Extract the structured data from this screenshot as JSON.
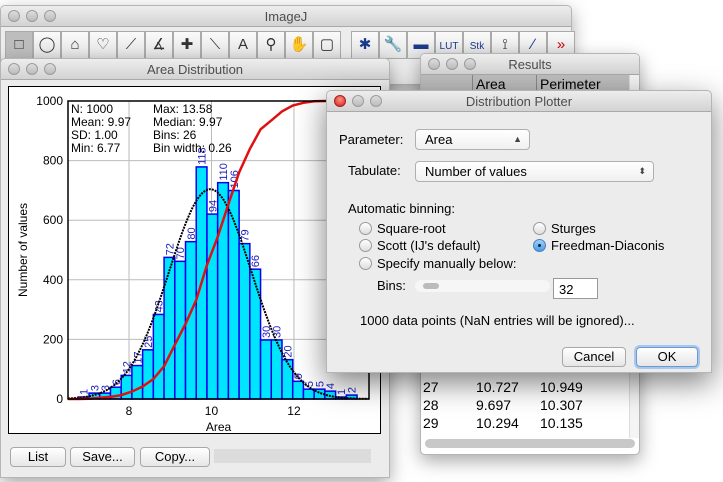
{
  "imagej": {
    "title": "ImageJ",
    "tools": [
      {
        "icon": "rectangle-icon",
        "glyph": "□"
      },
      {
        "icon": "oval-icon",
        "glyph": "◯"
      },
      {
        "icon": "polygon-icon",
        "glyph": "⌂"
      },
      {
        "icon": "freehand-icon",
        "glyph": "♡"
      },
      {
        "icon": "line-icon",
        "glyph": "⟋"
      },
      {
        "icon": "angle-icon",
        "glyph": "∡"
      },
      {
        "icon": "point-icon",
        "glyph": "✚"
      },
      {
        "icon": "wand-icon",
        "glyph": "⟍"
      },
      {
        "icon": "text-icon",
        "glyph": "A"
      },
      {
        "icon": "magnifier-icon",
        "glyph": "⚲"
      },
      {
        "icon": "hand-icon",
        "glyph": "✋"
      },
      {
        "icon": "color-picker-icon",
        "glyph": "▢"
      },
      {
        "icon": "gear-icon",
        "glyph": "✱"
      },
      {
        "icon": "wrench-icon",
        "glyph": "🔧"
      },
      {
        "icon": "folder-icon",
        "glyph": "▬"
      },
      {
        "icon": "lut-icon",
        "glyph": "LUT"
      },
      {
        "icon": "stack-icon",
        "glyph": "Stk"
      },
      {
        "icon": "microscope-icon",
        "glyph": "⟟"
      },
      {
        "icon": "brush-icon",
        "glyph": "∕"
      },
      {
        "icon": "more-tools-icon",
        "glyph": "»"
      }
    ]
  },
  "area_distribution": {
    "title": "Area Distribution",
    "buttons": {
      "list": "List",
      "save": "Save...",
      "copy": "Copy..."
    }
  },
  "results": {
    "title": "Results",
    "columns": [
      "",
      "Area",
      "Perimeter"
    ],
    "rows": [
      [
        "27",
        "10.727",
        "10.949"
      ],
      [
        "28",
        "9.697",
        "10.307"
      ],
      [
        "29",
        "10.294",
        "10.135"
      ]
    ]
  },
  "dialog": {
    "title": "Distribution Plotter",
    "parameter_label": "Parameter:",
    "parameter_value": "Area",
    "tabulate_label": "Tabulate:",
    "tabulate_value": "Number of values",
    "binning_label": "Automatic binning:",
    "options": {
      "square_root": "Square-root",
      "sturges": "Sturges",
      "scott": "Scott (IJ's default)",
      "freedman": "Freedman-Diaconis",
      "manual": "Specify manually below:"
    },
    "selected": "freedman",
    "bins_label": "Bins:",
    "bins_value": "32",
    "info": "1000 data points (NaN entries will be ignored)...",
    "cancel": "Cancel",
    "ok": "OK"
  },
  "chart_data": {
    "type": "bar",
    "xlabel": "Area",
    "ylabel": "Number of values",
    "xlim": [
      6.52,
      13.82
    ],
    "ylim": [
      0,
      1000
    ],
    "xticks": [
      "8",
      "10",
      "12"
    ],
    "yticks": [
      "0",
      "200",
      "400",
      "600",
      "800",
      "1000"
    ],
    "grid": true,
    "stats": {
      "left": [
        "N: 1000",
        "Mean: 9.97",
        "SD: 1.00",
        "Min: 6.77"
      ],
      "right": [
        "Max: 13.58",
        "Median: 9.97",
        "Bins: 26",
        "Bin width: 0.26"
      ]
    },
    "bin_start": 6.77,
    "bin_width": 0.26,
    "counts": [
      1,
      3,
      3,
      6,
      12,
      17,
      25,
      43,
      72,
      70,
      80,
      118,
      94,
      110,
      106,
      79,
      66,
      30,
      30,
      20,
      9,
      5,
      5,
      4,
      1,
      2
    ],
    "normal_fit": {
      "mean": 9.97,
      "sd": 1.0,
      "peak": 704
    },
    "cumulative_total": 1000,
    "colors": {
      "bars": "#00e5ff",
      "bar_edge": "#0000ee",
      "labels": "#2020c0",
      "fit": "#000000",
      "cumulative": "#e01010"
    }
  }
}
